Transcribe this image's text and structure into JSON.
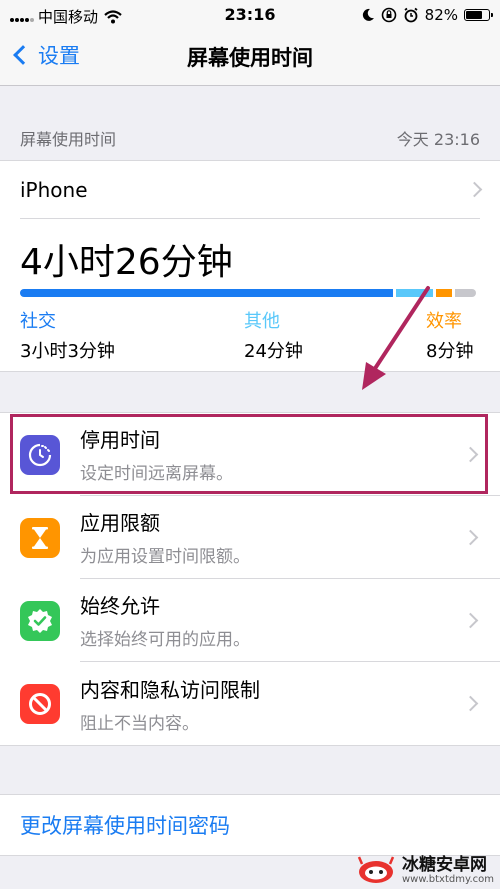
{
  "status_bar": {
    "carrier": "中国移动",
    "time": "23:16",
    "battery": "82%",
    "battery_level": 0.82,
    "icons": [
      "signal-icon",
      "wifi-icon",
      "moon-icon",
      "rotation-lock-icon",
      "alarm-icon",
      "battery-icon"
    ]
  },
  "nav": {
    "back_label": "设置",
    "title": "屏幕使用时间"
  },
  "summary": {
    "section_label": "屏幕使用时间",
    "date_time": "今天 23:16",
    "device": "iPhone",
    "total": "4小时26分钟",
    "segments": [
      {
        "name": "social",
        "fraction": 0.81,
        "color": "#1a7cf2"
      },
      {
        "name": "other",
        "fraction": 0.08,
        "color": "#5ac8fa"
      },
      {
        "name": "productivity",
        "fraction": 0.035,
        "color": "#ff9500"
      },
      {
        "name": "rest",
        "fraction": 0.045,
        "color": "#c7c7cc"
      }
    ],
    "categories": [
      {
        "name": "社交",
        "value": "3小时3分钟",
        "color": "#1a7cf2"
      },
      {
        "name": "其他",
        "value": "24分钟",
        "color": "#5ac8fa"
      },
      {
        "name": "效率",
        "value": "8分钟",
        "color": "#ff9500"
      }
    ]
  },
  "features": [
    {
      "title": "停用时间",
      "subtitle": "设定时间远离屏幕。",
      "icon": "downtime-icon",
      "color": "#5856d6"
    },
    {
      "title": "应用限额",
      "subtitle": "为应用设置时间限额。",
      "icon": "hourglass-icon",
      "color": "#ff9500"
    },
    {
      "title": "始终允许",
      "subtitle": "选择始终可用的应用。",
      "icon": "checkmark-badge-icon",
      "color": "#34c759"
    },
    {
      "title": "内容和隐私访问限制",
      "subtitle": "阻止不当内容。",
      "icon": "prohibited-icon",
      "color": "#ff3b30"
    }
  ],
  "password_link": "更改屏幕使用时间密码",
  "annotation_color": "#b0265e",
  "watermark": {
    "title": "冰糖安卓网",
    "url": "www.btxtdmy.com"
  }
}
